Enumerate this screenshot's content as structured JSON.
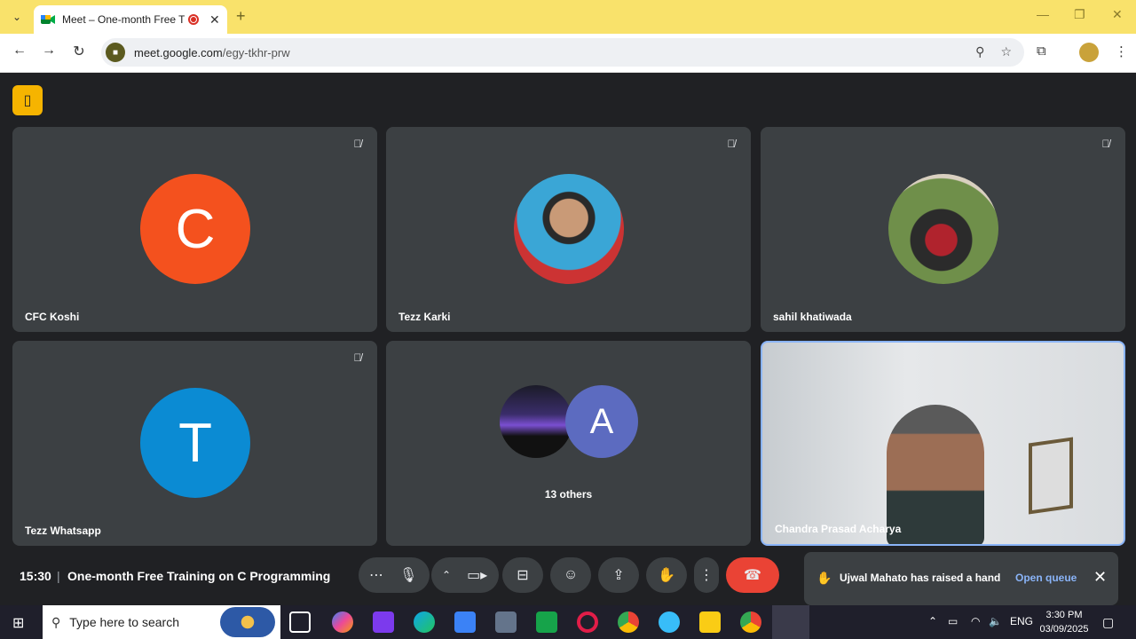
{
  "browser": {
    "tab_title": "Meet – One-month Free Tra",
    "url_host": "meet.google.com",
    "url_path": "/egy-tkhr-prw",
    "new_tab": "+",
    "tab_close": "✕"
  },
  "tiles": [
    {
      "name": "CFC Koshi",
      "initial": "C",
      "color": "#f4511e",
      "muted": true
    },
    {
      "name": "Tezz Karki",
      "initial": "",
      "muted": true
    },
    {
      "name": "sahil khatiwada",
      "initial": "",
      "muted": true
    },
    {
      "name": "Tezz Whatsapp",
      "initial": "T",
      "color": "#0b8bd3",
      "muted": true
    },
    {
      "name": "13 others",
      "initial": "A",
      "color": "#5c6bc0"
    },
    {
      "name": "Chandra Prasad Acharya",
      "active": true
    }
  ],
  "meeting": {
    "time": "15:30",
    "separator": "|",
    "title": "One-month Free Training on C Programming"
  },
  "notification": {
    "message": "Ujwal Mahato has raised a hand",
    "link": "Open queue"
  },
  "taskbar": {
    "search_placeholder": "Type here to search",
    "lang": "ENG",
    "time": "3:30 PM",
    "date": "03/09/2025"
  }
}
